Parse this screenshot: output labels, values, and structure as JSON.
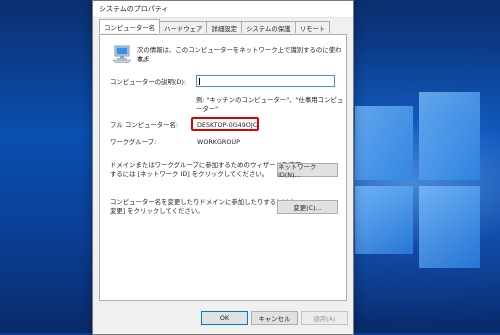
{
  "window": {
    "title": "システムのプロパティ"
  },
  "tabs": [
    {
      "label": "コンピューター名",
      "active": true
    },
    {
      "label": "ハードウェア",
      "active": false
    },
    {
      "label": "詳細設定",
      "active": false
    },
    {
      "label": "システムの保護",
      "active": false
    },
    {
      "label": "リモート",
      "active": false
    }
  ],
  "panel": {
    "intro_line1": "次の情報は、このコンピューターをネットワーク上で識別するのに使われま",
    "intro_line2": "す。",
    "description_label": "コンピューターの説明(D):",
    "description_value": "",
    "example": "例: \"キッチンのコンピューター\"、\"仕事用コンピューター\"",
    "full_name_label": "フル コンピューター名:",
    "full_name_value": "DESKTOP-0G49OJC",
    "workgroup_label": "ワークグループ:",
    "workgroup_value": "WORKGROUP",
    "network_text_line1": "ドメインまたはワークグループに参加するためのウィザードを使用",
    "network_text_line2": "するには [ネットワーク ID] をクリックしてください。",
    "network_button": "ネットワーク ID(N)...",
    "change_text_line1": "コンピューター名を変更したりドメインに参加したりするには [",
    "change_text_line2": "変更] をクリックしてください。",
    "change_button": "変更(C)..."
  },
  "footer": {
    "ok": "OK",
    "cancel": "キャンセル",
    "apply": "適用(A)"
  },
  "colors": {
    "highlight_border": "#e00000",
    "focus_border": "#0078d7"
  }
}
